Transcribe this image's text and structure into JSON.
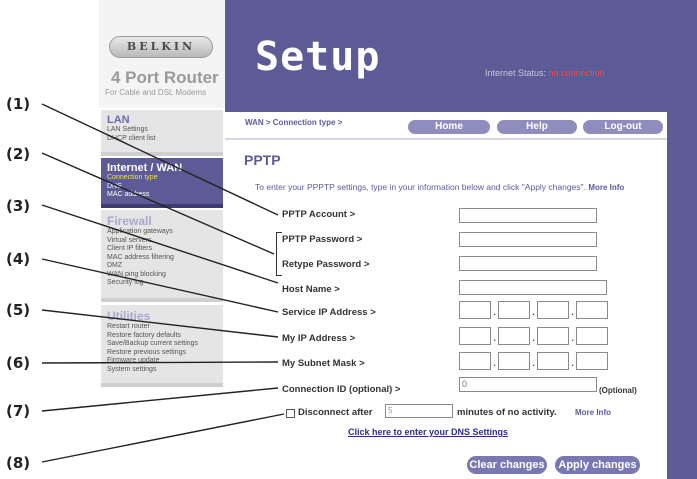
{
  "brand": {
    "logo_text": "BELKIN",
    "product": "4 Port Router",
    "product_sub": "For Cable and DSL Modems"
  },
  "header": {
    "title": "Setup",
    "status_label": "Internet Status:",
    "status_value": "no connection"
  },
  "sidebar": {
    "lan": {
      "title": "LAN",
      "items": [
        "LAN Settings",
        "DHCP client list"
      ]
    },
    "wan": {
      "title": "Internet / WAN",
      "items": [
        "Connection type",
        "DNS",
        "MAC address"
      ],
      "selected": "Connection type"
    },
    "firewall": {
      "title": "Firewall",
      "items": [
        "Application gateways",
        "Virtual servers",
        "Client IP filters",
        "MAC address filtering",
        "DMZ",
        "WAN ping blocking",
        "Security log"
      ]
    },
    "utilities": {
      "title": "Utilities",
      "items": [
        "Restart router",
        "Restore factory defaults",
        "Save/Backup current settings",
        "Restore previous settings",
        "Firmware update",
        "System settings"
      ]
    }
  },
  "nav": {
    "breadcrumb": "WAN > Connection type >",
    "home": "Home",
    "help": "Help",
    "logout": "Log-out"
  },
  "content": {
    "heading": "PPTP",
    "intro": "To enter your PPPTP settings, type in your information below and click \"Apply changes\".",
    "intro_more": "More Info",
    "fields": {
      "account": {
        "label": "PPTP Account >",
        "value": ""
      },
      "password": {
        "label": "PPTP Password >",
        "value": ""
      },
      "retype": {
        "label": "Retype Password >",
        "value": ""
      },
      "host": {
        "label": "Host Name >",
        "value": ""
      },
      "service_ip": {
        "label": "Service IP Address >"
      },
      "my_ip": {
        "label": "My IP Address >"
      },
      "subnet": {
        "label": "My Subnet Mask >"
      },
      "connection_id": {
        "label": "Connection ID (optional) >",
        "value": "0",
        "tag": "(Optional)"
      }
    },
    "disconnect": {
      "label": "Disconnect after",
      "minutes_value": "5",
      "suffix": "minutes of no activity.",
      "more": "More Info"
    },
    "dns_link": "Click here to enter your DNS Settings",
    "clear_button": "Clear changes",
    "apply_button": "Apply changes"
  },
  "callouts": [
    "(1)",
    "(2)",
    "(3)",
    "(4)",
    "(5)",
    "(6)",
    "(7)",
    "(8)"
  ],
  "colors": {
    "accent": "#5d5b95",
    "status_red": "#ff4444"
  }
}
